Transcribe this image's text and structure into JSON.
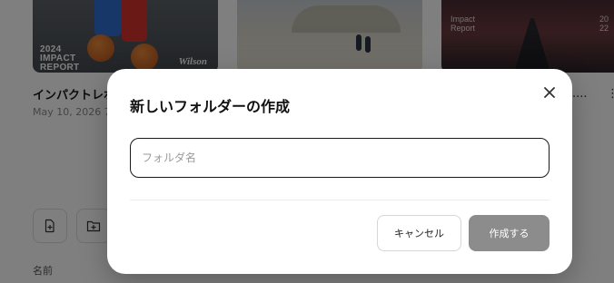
{
  "background": {
    "cards": [
      {
        "title": "インパクトレポ",
        "date": "May 10, 2026 7",
        "thumb_text": [
          "2024",
          "IMPACT",
          "REPORT"
        ],
        "brand": "Wilson"
      },
      {},
      {
        "thumb_text": [
          "Impact",
          "Report"
        ],
        "thumb_side": [
          "20",
          "22"
        ]
      }
    ],
    "ellipsis": "....",
    "more_glyph": "⋮",
    "column_header": "名前"
  },
  "dialog": {
    "title": "新しいフォルダーの作成",
    "input": {
      "value": "",
      "placeholder": "フォルダ名"
    },
    "cancel_label": "キャンセル",
    "create_label": "作成する",
    "close_icon": "close-icon"
  },
  "colors": {
    "overlay": "rgba(0,0,0,0.5)",
    "create_button_disabled": "#8c8c8c",
    "input_border": "#1a1a1a"
  }
}
